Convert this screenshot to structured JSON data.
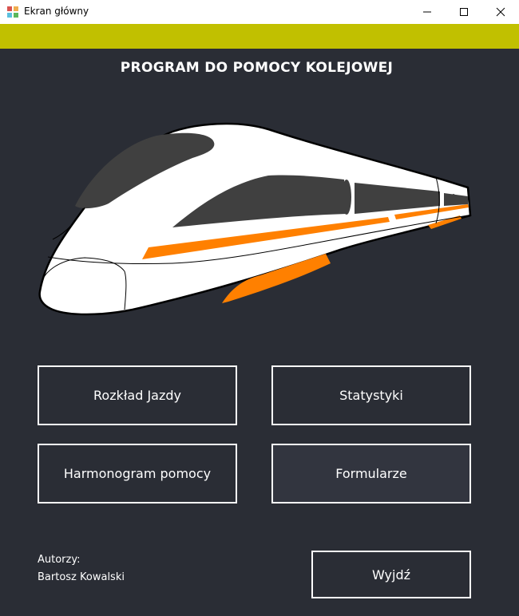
{
  "window": {
    "title": "Ekran główny"
  },
  "header": {
    "title": "PROGRAM DO POMOCY KOLEJOWEJ"
  },
  "menu": {
    "timetable": "Rozkład Jazdy",
    "statistics": "Statystyki",
    "assistance_schedule": "Harmonogram pomocy",
    "forms": "Formularze"
  },
  "footer": {
    "authors_label": "Autorzy:",
    "author_name": "Bartosz Kowalski",
    "exit": "Wyjdź"
  },
  "colors": {
    "background": "#2a2d35",
    "accent_bar": "#c1c000",
    "train_stripe": "#ff8000",
    "button_border": "#ffffff"
  }
}
